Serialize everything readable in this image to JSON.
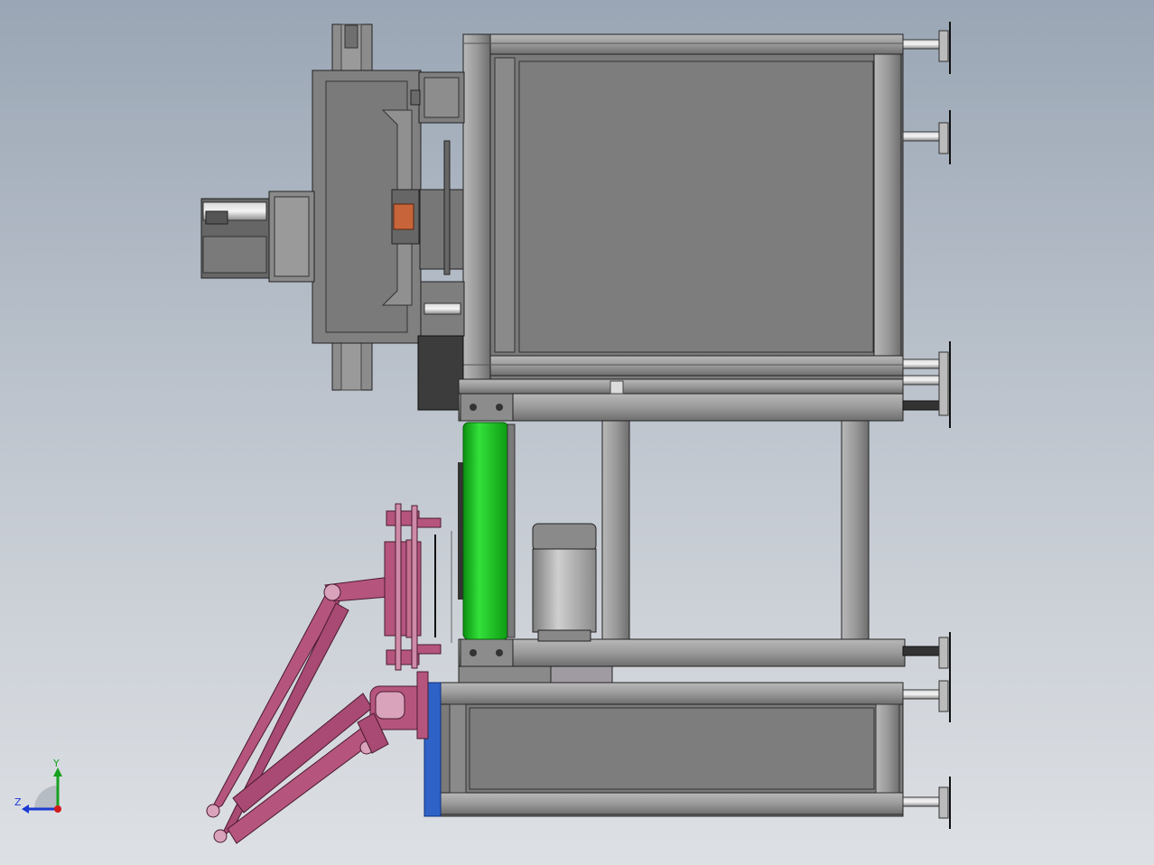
{
  "viewport": {
    "background_top": "#9aa6b5",
    "background_bottom": "#dde0e4"
  },
  "triad": {
    "y_label": "Y",
    "z_label": "Z",
    "x_color": "#d11a1a",
    "y_color": "#16a11e",
    "z_color": "#1c3ad1"
  },
  "colors": {
    "frame": "#8c8c8c",
    "frame_dark": "#5e5e5e",
    "panel": "#7f7f7f",
    "roller_green": "#16c21a",
    "arm_pink": "#b5557e",
    "motor_grey": "#a9a9a9",
    "blue_plate": "#2e62c7",
    "orange_part": "#c8643a"
  }
}
